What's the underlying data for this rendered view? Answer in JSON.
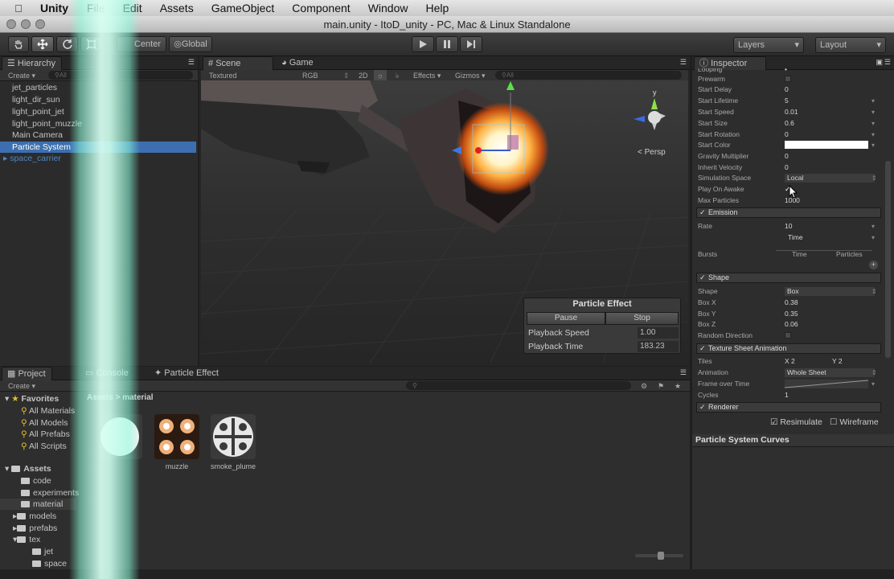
{
  "menubar": {
    "app": "Unity",
    "items": [
      "File",
      "Edit",
      "Assets",
      "GameObject",
      "Component",
      "Window",
      "Help"
    ]
  },
  "titlebar": {
    "title": "main.unity - ItoD_unity - PC, Mac & Linux Standalone"
  },
  "toolbar": {
    "pivot": "Center",
    "space": "Global",
    "layers": "Layers",
    "layout": "Layout"
  },
  "hierarchy": {
    "tab": "Hierarchy",
    "create": "Create",
    "search_placeholder": "All",
    "items": [
      "jet_particles",
      "light_dir_sun",
      "light_point_jet",
      "light_point_muzzle",
      "Main Camera",
      "Particle System",
      "space_carrier"
    ]
  },
  "scene": {
    "tab_scene": "Scene",
    "tab_game": "Game",
    "render_mode": "Textured",
    "channels": "RGB",
    "mode_2d": "2D",
    "effects": "Effects",
    "gizmos": "Gizmos",
    "search_placeholder": "All",
    "persp": "Persp",
    "axis_y": "y"
  },
  "particle_effect": {
    "title": "Particle Effect",
    "pause": "Pause",
    "stop": "Stop",
    "speed_label": "Playback Speed",
    "speed_value": "1.00",
    "time_label": "Playback Time",
    "time_value": "183.23"
  },
  "project": {
    "tab": "Project",
    "tab_console": "Console",
    "tab_particle": "Particle Effect",
    "create": "Create",
    "favorites_label": "Favorites",
    "favorites": [
      "All Materials",
      "All Models",
      "All Prefabs",
      "All Scripts"
    ],
    "assets_label": "Assets",
    "folders": [
      "code",
      "experiments",
      "material",
      "models",
      "prefabs",
      "tex"
    ],
    "subfolders": [
      "jet",
      "space"
    ],
    "breadcrumb": "Assets > material",
    "assets": [
      "",
      "muzzle",
      "smoke_plume"
    ]
  },
  "inspector": {
    "tab": "Inspector",
    "rows_top": [
      {
        "label": "Looping",
        "value": "•"
      },
      {
        "label": "Prewarm",
        "value": ""
      },
      {
        "label": "Start Delay",
        "value": "0"
      },
      {
        "label": "Start Lifetime",
        "value": "5"
      },
      {
        "label": "Start Speed",
        "value": "0.01"
      },
      {
        "label": "Start Size",
        "value": "0.6"
      },
      {
        "label": "Start Rotation",
        "value": "0"
      },
      {
        "label": "Start Color",
        "value": ""
      },
      {
        "label": "Gravity Multiplier",
        "value": "0"
      },
      {
        "label": "Inherit Velocity",
        "value": "0"
      },
      {
        "label": "Simulation Space",
        "value": "Local"
      },
      {
        "label": "Play On Awake",
        "value": "✓"
      },
      {
        "label": "Max Particles",
        "value": "1000"
      }
    ],
    "emission_header": "Emission",
    "rate_label": "Rate",
    "rate_value": "10",
    "rate_mode": "Time",
    "bursts_label": "Bursts",
    "bursts_time": "Time",
    "bursts_particles": "Particles",
    "shape_header": "Shape",
    "shape_rows": [
      {
        "label": "Shape",
        "value": "Box"
      },
      {
        "label": "Box X",
        "value": "0.38"
      },
      {
        "label": "Box Y",
        "value": "0.35"
      },
      {
        "label": "Box Z",
        "value": "0.06"
      },
      {
        "label": "Random Direction",
        "value": ""
      }
    ],
    "tsa_header": "Texture Sheet Animation",
    "tiles_label": "Tiles",
    "tiles_x": "X  2",
    "tiles_y": "Y  2",
    "animation_label": "Animation",
    "animation_value": "Whole Sheet",
    "frame_label": "Frame over Time",
    "cycles_label": "Cycles",
    "cycles_value": "1",
    "renderer_header": "Renderer",
    "resimulate": "Resimulate",
    "wireframe": "Wireframe",
    "curves_title": "Particle System Curves"
  },
  "colors": {
    "selection": "#3d6fb0",
    "prefab": "#4d88c7",
    "accent_glow": "#d7fff2"
  }
}
